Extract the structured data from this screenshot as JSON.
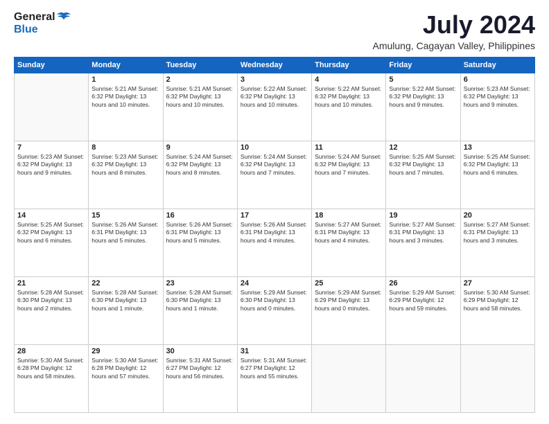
{
  "header": {
    "logo_general": "General",
    "logo_blue": "Blue",
    "title": "July 2024",
    "location": "Amulung, Cagayan Valley, Philippines"
  },
  "days_of_week": [
    "Sunday",
    "Monday",
    "Tuesday",
    "Wednesday",
    "Thursday",
    "Friday",
    "Saturday"
  ],
  "weeks": [
    [
      {
        "day": "",
        "info": ""
      },
      {
        "day": "1",
        "info": "Sunrise: 5:21 AM\nSunset: 6:32 PM\nDaylight: 13 hours\nand 10 minutes."
      },
      {
        "day": "2",
        "info": "Sunrise: 5:21 AM\nSunset: 6:32 PM\nDaylight: 13 hours\nand 10 minutes."
      },
      {
        "day": "3",
        "info": "Sunrise: 5:22 AM\nSunset: 6:32 PM\nDaylight: 13 hours\nand 10 minutes."
      },
      {
        "day": "4",
        "info": "Sunrise: 5:22 AM\nSunset: 6:32 PM\nDaylight: 13 hours\nand 10 minutes."
      },
      {
        "day": "5",
        "info": "Sunrise: 5:22 AM\nSunset: 6:32 PM\nDaylight: 13 hours\nand 9 minutes."
      },
      {
        "day": "6",
        "info": "Sunrise: 5:23 AM\nSunset: 6:32 PM\nDaylight: 13 hours\nand 9 minutes."
      }
    ],
    [
      {
        "day": "7",
        "info": "Sunrise: 5:23 AM\nSunset: 6:32 PM\nDaylight: 13 hours\nand 9 minutes."
      },
      {
        "day": "8",
        "info": "Sunrise: 5:23 AM\nSunset: 6:32 PM\nDaylight: 13 hours\nand 8 minutes."
      },
      {
        "day": "9",
        "info": "Sunrise: 5:24 AM\nSunset: 6:32 PM\nDaylight: 13 hours\nand 8 minutes."
      },
      {
        "day": "10",
        "info": "Sunrise: 5:24 AM\nSunset: 6:32 PM\nDaylight: 13 hours\nand 7 minutes."
      },
      {
        "day": "11",
        "info": "Sunrise: 5:24 AM\nSunset: 6:32 PM\nDaylight: 13 hours\nand 7 minutes."
      },
      {
        "day": "12",
        "info": "Sunrise: 5:25 AM\nSunset: 6:32 PM\nDaylight: 13 hours\nand 7 minutes."
      },
      {
        "day": "13",
        "info": "Sunrise: 5:25 AM\nSunset: 6:32 PM\nDaylight: 13 hours\nand 6 minutes."
      }
    ],
    [
      {
        "day": "14",
        "info": "Sunrise: 5:25 AM\nSunset: 6:32 PM\nDaylight: 13 hours\nand 6 minutes."
      },
      {
        "day": "15",
        "info": "Sunrise: 5:26 AM\nSunset: 6:31 PM\nDaylight: 13 hours\nand 5 minutes."
      },
      {
        "day": "16",
        "info": "Sunrise: 5:26 AM\nSunset: 6:31 PM\nDaylight: 13 hours\nand 5 minutes."
      },
      {
        "day": "17",
        "info": "Sunrise: 5:26 AM\nSunset: 6:31 PM\nDaylight: 13 hours\nand 4 minutes."
      },
      {
        "day": "18",
        "info": "Sunrise: 5:27 AM\nSunset: 6:31 PM\nDaylight: 13 hours\nand 4 minutes."
      },
      {
        "day": "19",
        "info": "Sunrise: 5:27 AM\nSunset: 6:31 PM\nDaylight: 13 hours\nand 3 minutes."
      },
      {
        "day": "20",
        "info": "Sunrise: 5:27 AM\nSunset: 6:31 PM\nDaylight: 13 hours\nand 3 minutes."
      }
    ],
    [
      {
        "day": "21",
        "info": "Sunrise: 5:28 AM\nSunset: 6:30 PM\nDaylight: 13 hours\nand 2 minutes."
      },
      {
        "day": "22",
        "info": "Sunrise: 5:28 AM\nSunset: 6:30 PM\nDaylight: 13 hours\nand 1 minute."
      },
      {
        "day": "23",
        "info": "Sunrise: 5:28 AM\nSunset: 6:30 PM\nDaylight: 13 hours\nand 1 minute."
      },
      {
        "day": "24",
        "info": "Sunrise: 5:29 AM\nSunset: 6:30 PM\nDaylight: 13 hours\nand 0 minutes."
      },
      {
        "day": "25",
        "info": "Sunrise: 5:29 AM\nSunset: 6:29 PM\nDaylight: 13 hours\nand 0 minutes."
      },
      {
        "day": "26",
        "info": "Sunrise: 5:29 AM\nSunset: 6:29 PM\nDaylight: 12 hours\nand 59 minutes."
      },
      {
        "day": "27",
        "info": "Sunrise: 5:30 AM\nSunset: 6:29 PM\nDaylight: 12 hours\nand 58 minutes."
      }
    ],
    [
      {
        "day": "28",
        "info": "Sunrise: 5:30 AM\nSunset: 6:28 PM\nDaylight: 12 hours\nand 58 minutes."
      },
      {
        "day": "29",
        "info": "Sunrise: 5:30 AM\nSunset: 6:28 PM\nDaylight: 12 hours\nand 57 minutes."
      },
      {
        "day": "30",
        "info": "Sunrise: 5:31 AM\nSunset: 6:27 PM\nDaylight: 12 hours\nand 56 minutes."
      },
      {
        "day": "31",
        "info": "Sunrise: 5:31 AM\nSunset: 6:27 PM\nDaylight: 12 hours\nand 55 minutes."
      },
      {
        "day": "",
        "info": ""
      },
      {
        "day": "",
        "info": ""
      },
      {
        "day": "",
        "info": ""
      }
    ]
  ]
}
